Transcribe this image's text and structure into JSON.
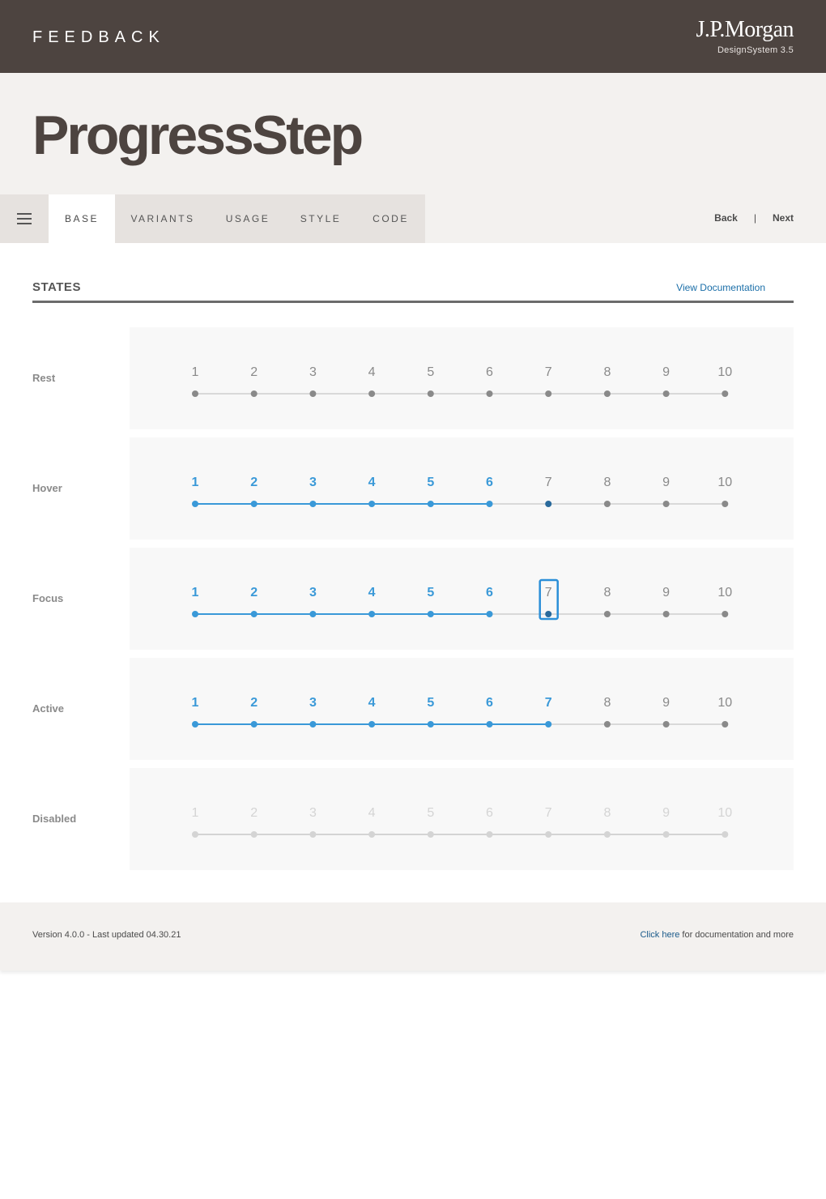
{
  "header": {
    "section_title": "FEEDBACK",
    "brand_logo": "J.P.Morgan",
    "brand_sub": "DesignSystem  3.5"
  },
  "page_title": "ProgressStep",
  "tabs": [
    {
      "label": "BASE",
      "active": true
    },
    {
      "label": "VARIANTS",
      "active": false
    },
    {
      "label": "USAGE",
      "active": false
    },
    {
      "label": "STYLE",
      "active": false
    },
    {
      "label": "CODE",
      "active": false
    }
  ],
  "menu_icon": "hamburger-icon",
  "pager": {
    "back": "Back",
    "separator": "|",
    "next": "Next"
  },
  "states_section": {
    "title": "STATES",
    "doc_link": "View Documentation"
  },
  "steps": [
    "1",
    "2",
    "3",
    "4",
    "5",
    "6",
    "7",
    "8",
    "9",
    "10"
  ],
  "states": [
    {
      "label": "Rest",
      "state": "rest",
      "completed": 0
    },
    {
      "label": "Hover",
      "state": "hover",
      "completed": 6,
      "hovered_step": 7
    },
    {
      "label": "Focus",
      "state": "focus",
      "completed": 6,
      "focused_step": 7
    },
    {
      "label": "Active",
      "state": "active",
      "completed": 7
    },
    {
      "label": "Disabled",
      "state": "disabled",
      "completed": 0
    }
  ],
  "colors": {
    "header_bg": "#4d4440",
    "hero_bg": "#f3f1ef",
    "accent_blue": "#3a99d8",
    "hover_dot": "#2a6a9c",
    "focus_ring": "#2b8fd8",
    "rest_dot": "#8a8a8a",
    "track": "#d9d9d9",
    "disabled": "#d4d4d4",
    "link": "#1a6ea8"
  },
  "footer": {
    "version": "Version 4.0.0 - Last updated 04.30.21",
    "link_text": "Click here",
    "rest_text": " for documentation and more"
  }
}
